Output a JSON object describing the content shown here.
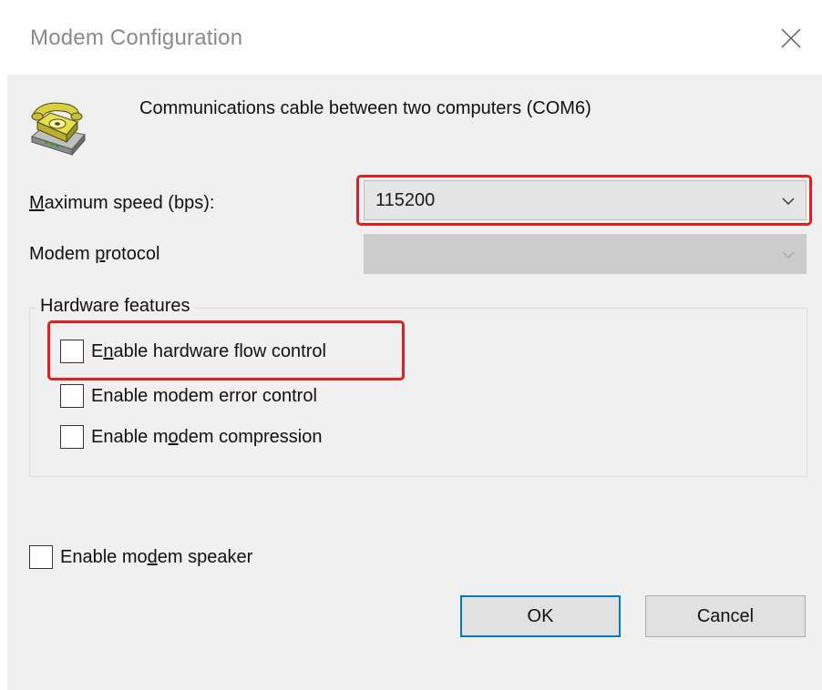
{
  "window": {
    "title": "Modem Configuration"
  },
  "device": {
    "name": "Communications cable between two computers (COM6)",
    "icon": "telephone-icon"
  },
  "speed": {
    "label_pre": "",
    "label_accel": "M",
    "label_post": "aximum speed (bps):",
    "value": "115200"
  },
  "protocol": {
    "label_pre": "Modem ",
    "label_accel": "p",
    "label_post": "rotocol",
    "value": ""
  },
  "hardware": {
    "title": "Hardware features",
    "flow_control": {
      "label_pre": "E",
      "label_accel": "n",
      "label_post": "able hardware flow control",
      "checked": false
    },
    "error_control": {
      "label": "Enable modem error control",
      "checked": false
    },
    "compression": {
      "label_pre": "Enable m",
      "label_accel": "o",
      "label_post": "dem compression",
      "checked": false
    }
  },
  "speaker": {
    "label_pre": "Enable mo",
    "label_accel": "d",
    "label_post": "em speaker",
    "checked": false
  },
  "buttons": {
    "ok": "OK",
    "cancel": "Cancel"
  },
  "colors": {
    "highlight": "#e02020",
    "focus_border": "#0078d7",
    "dialog_bg": "#f0f0f0"
  }
}
